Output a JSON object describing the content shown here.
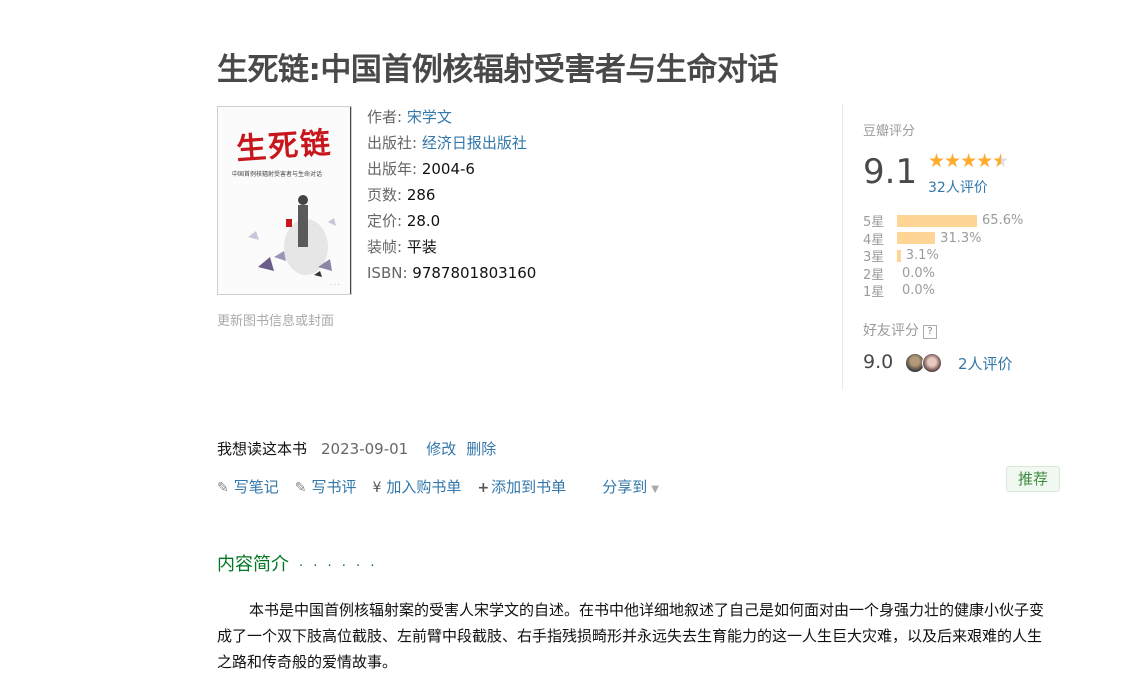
{
  "book": {
    "title": "生死链:中国首例核辐射受害者与生命对话",
    "cover_title": "生死链",
    "cover_subtitle": "中国首例核辐射受害者与生命对话",
    "update_link": "更新图书信息或封面"
  },
  "info": {
    "author_label": "作者: ",
    "author": "宋学文",
    "publisher_label": "出版社: ",
    "publisher": "经济日报出版社",
    "year_label": "出版年: ",
    "year": "2004-6",
    "pages_label": "页数: ",
    "pages": "286",
    "price_label": "定价: ",
    "price": "28.0",
    "binding_label": "装帧: ",
    "binding": "平装",
    "isbn_label": "ISBN: ",
    "isbn": "9787801803160"
  },
  "rating": {
    "label": "豆瓣评分",
    "score": "9.1",
    "stars": 4.5,
    "votes": "32人评价",
    "breakdown": [
      {
        "label": "5星",
        "pct": "65.6%",
        "value": 65.6
      },
      {
        "label": "4星",
        "pct": "31.3%",
        "value": 31.3
      },
      {
        "label": "3星",
        "pct": "3.1%",
        "value": 3.1
      },
      {
        "label": "2星",
        "pct": "0.0%",
        "value": 0.0
      },
      {
        "label": "1星",
        "pct": "0.0%",
        "value": 0.0
      }
    ],
    "friend_label": "好友评分",
    "friend_help": "?",
    "friend_score": "9.0",
    "friend_votes": "2人评价"
  },
  "status": {
    "want": "我想读这本书",
    "date": "2023-09-01",
    "edit": "修改",
    "delete": "删除"
  },
  "actions": {
    "note": "写笔记",
    "review": "写书评",
    "cart": "加入购书单",
    "booklist": "添加到书单",
    "share": "分享到",
    "recommend": "推荐"
  },
  "intro": {
    "title": "内容简介",
    "dots": "· · · · · ·",
    "text": "本书是中国首例核辐射案的受害人宋学文的自述。在书中他详细地叙述了自己是如何面对由一个身强力壮的健康小伙子变成了一个双下肢高位截肢、左前臂中段截肢、右手指残损畸形并永远失去生育能力的这一人生巨大灾难，以及后来艰难的人生之路和传奇般的爱情故事。"
  },
  "colors": {
    "link": "#3377aa",
    "star": "#ffac2d",
    "bar": "#ffd596",
    "section_title": "#007722"
  }
}
